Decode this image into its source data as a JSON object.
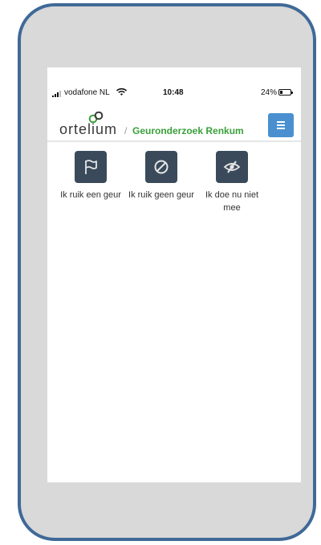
{
  "status_bar": {
    "carrier": "vodafone NL",
    "time": "10:48",
    "battery_percent": "24%",
    "battery_level": 0.24,
    "signal_icon": "signal-bars-icon",
    "wifi_icon": "wifi-icon",
    "battery_icon": "battery-icon"
  },
  "header": {
    "logo_text": "ortelium",
    "separator": "/",
    "title": "Geuronderzoek Renkum",
    "menu_icon": "hamburger-menu-icon"
  },
  "options": [
    {
      "label": "Ik ruik een geur",
      "icon": "flag-icon"
    },
    {
      "label": "Ik ruik geen geur",
      "icon": "no-entry-icon"
    },
    {
      "label": "Ik doe nu niet mee",
      "icon": "eye-off-icon"
    }
  ],
  "colors": {
    "frame": "#3f6997",
    "project_title": "#3aa03a",
    "menu_button": "#4a90d0",
    "option_tile": "#3a4a5a"
  }
}
